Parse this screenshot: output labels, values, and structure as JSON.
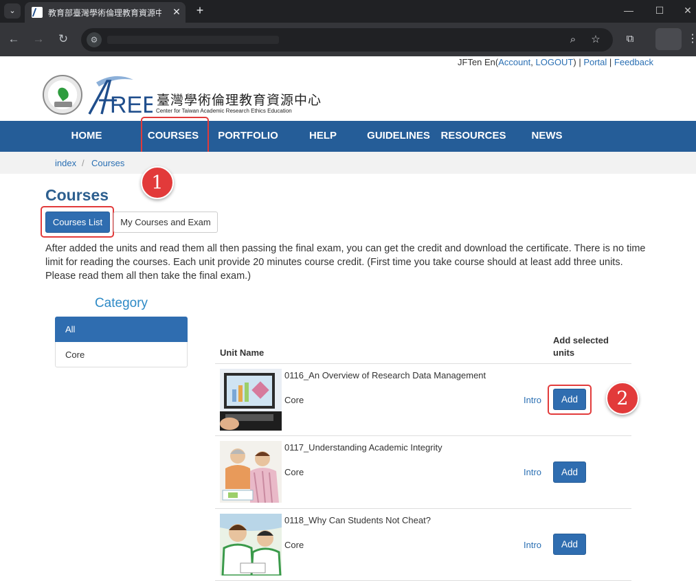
{
  "browser": {
    "tab_title": "教育部臺灣學術倫理教育資源中",
    "tab_close": "✕",
    "new_tab": "+",
    "tab_menu": "⌄"
  },
  "userbar": {
    "user": "JFTen En",
    "account": "Account",
    "logout": "LOGOUT",
    "portal": "Portal",
    "feedback": "Feedback"
  },
  "logo": {
    "cn": "臺灣學術倫理教育資源中心",
    "en": "Center for Taiwan Academic Research Ethics Education",
    "mark": "AREE",
    "seal_text": "MINISTRY OF EDUCATION 教育部"
  },
  "nav": {
    "items": [
      "HOME",
      "COURSES",
      "PORTFOLIO",
      "HELP",
      "GUIDELINES",
      "RESOURCES",
      "NEWS"
    ]
  },
  "breadcrumb": {
    "items": [
      "index",
      "Courses"
    ]
  },
  "markers": [
    "1",
    "2"
  ],
  "page": {
    "title": "Courses",
    "btn_list": "Courses List",
    "btn_my": "My Courses and Exam",
    "intro": "After added the units and read them all then passing the final exam, you can get the credit and download the certificate. There is no time limit for reading the courses. Each unit provide 20 minutes course credit. (First time you take course should at least add three units. Please read them all then take the final exam.)"
  },
  "category": {
    "title": "Category",
    "items": [
      "All",
      "Core"
    ]
  },
  "table": {
    "head_unit": "Unit Name",
    "head_add": "Add selected units",
    "rows": [
      {
        "name": "0116_An Overview of Research Data Management",
        "category": "Core",
        "intro": "Intro",
        "add": "Add"
      },
      {
        "name": "0117_Understanding Academic Integrity",
        "category": "Core",
        "intro": "Intro",
        "add": "Add"
      },
      {
        "name": "0118_Why Can Students Not Cheat?",
        "category": "Core",
        "intro": "Intro",
        "add": "Add"
      }
    ]
  },
  "colors": {
    "nav_bg": "#255d98",
    "accent": "#2f6db0",
    "highlight": "#e23a3a"
  }
}
